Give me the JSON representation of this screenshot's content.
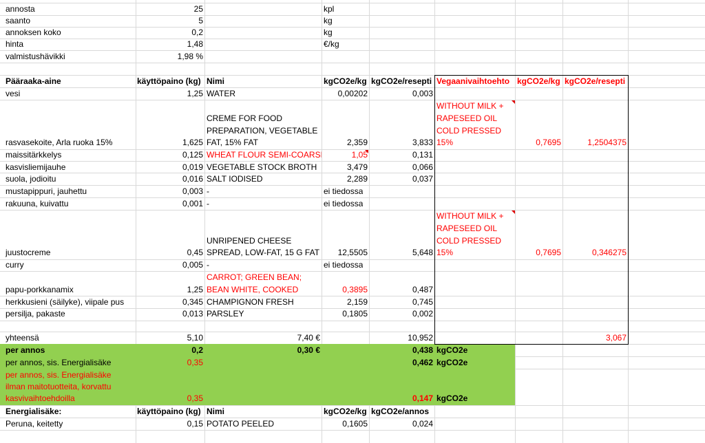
{
  "params": {
    "annosta": {
      "label": "annosta",
      "value": "25",
      "unit": "kpl"
    },
    "saanto": {
      "label": "saanto",
      "value": "5",
      "unit": "kg"
    },
    "annoksen_koko": {
      "label": "annoksen koko",
      "value": "0,2",
      "unit": "kg"
    },
    "hinta": {
      "label": "hinta",
      "value": "1,48",
      "unit": "€/kg"
    },
    "valmistushavikki": {
      "label": "valmistushävikki",
      "value": "1,98 %"
    }
  },
  "header": {
    "paaraaka": "Pääraaka-aine",
    "kayttopaino": "käyttöpaino (kg)",
    "nimi": "Nimi",
    "kgco2e_kg": "kgCO2e/kg",
    "kgco2e_resepti": "kgCO2e/resepti",
    "vegaani": "Vegaanivaihtoehto",
    "vegan_kgco2e_kg": "kgCO2e/kg",
    "vegan_kgco2e_resepti": "kgCO2e/resepti"
  },
  "rows": {
    "vesi": {
      "name": "vesi",
      "weight": "1,25",
      "nimi": "WATER",
      "kg": "0,00202",
      "resepti": "0,003"
    },
    "rasva": {
      "name": "rasvasekoite, Arla ruoka 15%",
      "weight": "1,625",
      "nimi1": "CREME FOR FOOD",
      "nimi2": "PREPARATION, VEGETABLE",
      "nimi3": "FAT, 15% FAT",
      "kg": "2,359",
      "resepti": "3,833",
      "vegan1": "WITHOUT MILK +",
      "vegan2": "RAPESEED OIL",
      "vegan3": "COLD PRESSED",
      "vegan4": "15%",
      "vegan_kg": "0,7695",
      "vegan_resepti": "1,2504375"
    },
    "maissi": {
      "name": "maissitärkkelys",
      "weight": "0,125",
      "nimi": "WHEAT FLOUR SEMI-COARSE",
      "kg": "1,05",
      "resepti": "0,131"
    },
    "kasvis": {
      "name": "kasvisliemijauhe",
      "weight": "0,019",
      "nimi": "VEGETABLE STOCK BROTH",
      "kg": "3,479",
      "resepti": "0,066"
    },
    "suola": {
      "name": "suola, jodioitu",
      "weight": "0,016",
      "nimi": "SALT IODISED",
      "kg": "2,289",
      "resepti": "0,037"
    },
    "musta": {
      "name": "mustapippuri, jauhettu",
      "weight": "0,003",
      "nimi": "-",
      "kg": "ei tiedossa"
    },
    "rakuuna": {
      "name": "rakuuna, kuivattu",
      "weight": "0,001",
      "nimi": "-",
      "kg": "ei tiedossa"
    },
    "juusto": {
      "name": "juustocreme",
      "weight": "0,45",
      "nimi1": "UNRIPENED CHEESE",
      "nimi2": "SPREAD, LOW-FAT, 15 G FAT",
      "kg": "12,5505",
      "resepti": "5,648",
      "vegan1": "WITHOUT MILK +",
      "vegan2": "RAPESEED OIL",
      "vegan3": "COLD PRESSED",
      "vegan4": "15%",
      "vegan_kg": "0,7695",
      "vegan_resepti": "0,346275"
    },
    "curry": {
      "name": "curry",
      "weight": "0,005",
      "nimi": "-",
      "kg": "ei tiedossa"
    },
    "papu": {
      "name": "papu-porkkanamix",
      "weight": "1,25",
      "nimi1": "CARROT; GREEN BEAN;",
      "nimi2": "BEAN WHITE, COOKED",
      "kg": "0,3895",
      "resepti": "0,487"
    },
    "herkku": {
      "name": "herkkusieni (säilyke), viipale pus",
      "weight": "0,345",
      "nimi": "CHAMPIGNON FRESH",
      "kg": "2,159",
      "resepti": "0,745"
    },
    "persilja": {
      "name": "persilja, pakaste",
      "weight": "0,013",
      "nimi": "PARSLEY",
      "kg": "0,1805",
      "resepti": "0,002"
    }
  },
  "totals": {
    "yhteensa": {
      "label": "yhteensä",
      "weight": "5,10",
      "price": "7,40 €",
      "resepti": "10,952",
      "vegan_resepti": "3,067"
    },
    "per_annos": {
      "label": "per annos",
      "weight": "0,2",
      "price": "0,30 €",
      "value": "0,438",
      "unit": "kgCO2e"
    },
    "per_annos_energia": {
      "label": "per annos, sis. Energialisäke",
      "weight": "0,35",
      "value": "0,462",
      "unit": "kgCO2e"
    },
    "per_annos_vegan": {
      "line1": "per annos, sis. Energialisäke",
      "line2": "ilman maitotuotteita, korvattu",
      "line3": "kasvivaihtoehdoilla",
      "weight": "0,35",
      "value": "0,147",
      "unit": "kgCO2e"
    }
  },
  "energia": {
    "header": {
      "label": "Energialisäke:",
      "kayttopaino": "käyttöpaino (kg)",
      "nimi": "Nimi",
      "kgco2e_kg": "kgCO2e/kg",
      "kgco2e_annos": "kgCO2e/annos"
    },
    "peruna": {
      "name": "Peruna, keitetty",
      "weight": "0,15",
      "nimi": "POTATO PEELED",
      "kg": "0,1605",
      "annos": "0,024"
    }
  },
  "colors": {
    "green_fill": "#92d050",
    "red_text": "#ff0000",
    "comment_marker": "#e00000",
    "gridline": "#d9d9d9"
  }
}
